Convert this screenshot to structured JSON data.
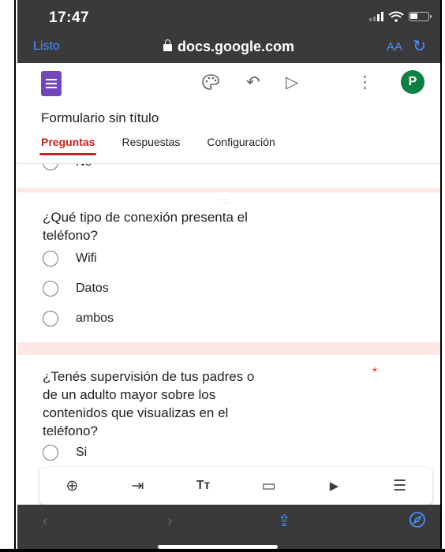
{
  "status": {
    "time": "17:47"
  },
  "browser": {
    "done_label": "Listo",
    "host": "docs.google.com",
    "aa_label": "AA",
    "reload_icon": "↻",
    "back_icon": "‹",
    "forward_icon": "›",
    "share_icon": "⇪",
    "compass_icon": "⊘"
  },
  "header": {
    "form_title": "Formulario sin título",
    "avatar_letter": "P",
    "icons": {
      "palette": "☺",
      "undo": "↶",
      "send": "▷",
      "more": "⋮"
    },
    "tabs": [
      {
        "label": "Preguntas",
        "active": true
      },
      {
        "label": "Respuestas",
        "active": false
      },
      {
        "label": "Configuración",
        "active": false
      }
    ]
  },
  "cards": {
    "prev_option": "No",
    "q1": {
      "drag_handle": ":::",
      "text_line1": "¿Qué tipo de conexión presenta el",
      "text_line2": "teléfono?",
      "options": [
        "Wifi",
        "Datos",
        "ambos"
      ]
    },
    "q2": {
      "text_line1": "¿Tenés supervisión de tus padres o",
      "text_line2": "de un adulto mayor sobre los",
      "text_line3": "contenidos que visualizas en el",
      "text_line4": "teléfono?",
      "required_mark": "*",
      "options": [
        "Si"
      ]
    }
  },
  "toolbar": {
    "add_icon": "⊕",
    "import_icon": "⇥",
    "title_icon": "Tт",
    "image_icon": "▭",
    "video_icon": "▶",
    "section_icon": "☰"
  },
  "colors": {
    "accent": "#c5221f",
    "forms_purple": "#7248b9",
    "avatar": "#0b8043",
    "browser_blue": "#4a90ff"
  }
}
